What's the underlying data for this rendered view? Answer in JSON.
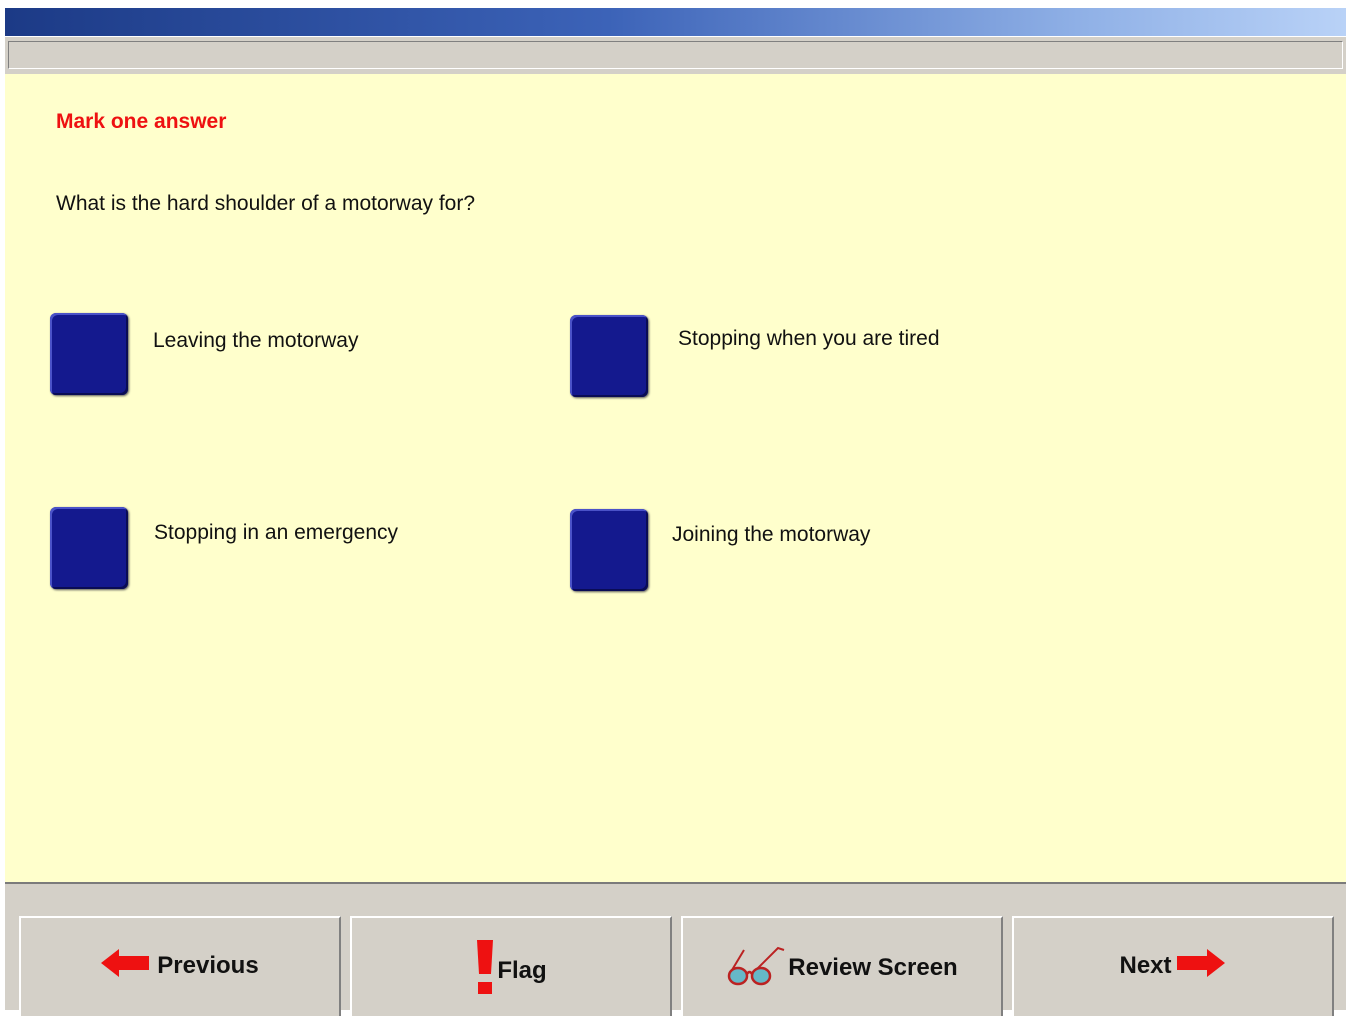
{
  "instruction": "Mark one answer",
  "question": "What is the hard shoulder of a motorway for?",
  "answers": [
    {
      "label": "Leaving the motorway",
      "selected": false
    },
    {
      "label": "Stopping when you are tired",
      "selected": false
    },
    {
      "label": "Stopping in an emergency",
      "selected": false
    },
    {
      "label": "Joining the motorway",
      "selected": false
    }
  ],
  "nav": {
    "previous": {
      "label": "Previous",
      "icon": "arrow-left-icon"
    },
    "flag": {
      "label": "Flag",
      "icon": "exclamation-icon"
    },
    "review": {
      "label": "Review Screen",
      "icon": "glasses-icon"
    },
    "next": {
      "label": "Next",
      "icon": "arrow-right-icon"
    }
  },
  "colors": {
    "content_bg": "#ffffcc",
    "answer_box": "#14198e",
    "instruction": "#ee1111",
    "nav_bg": "#d4d0c8",
    "arrow": "#ee1111"
  }
}
